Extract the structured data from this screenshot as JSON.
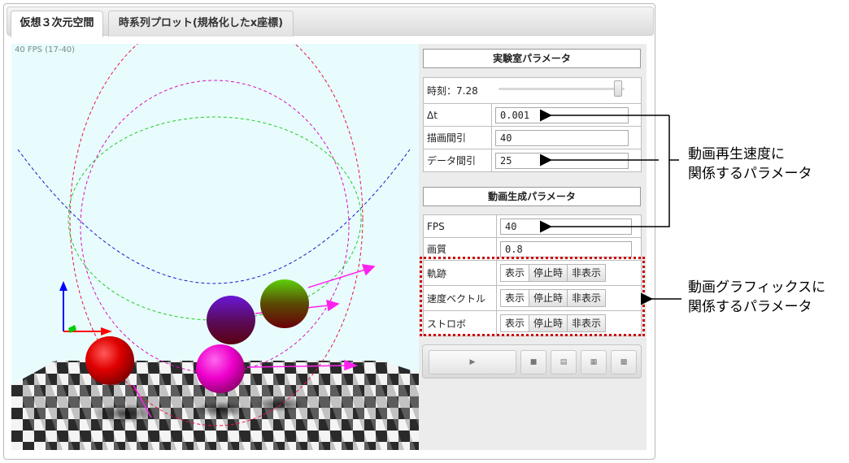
{
  "tabs": [
    {
      "label": "仮想３次元空間",
      "active": true
    },
    {
      "label": "時系列プロット(規格化したx座標)",
      "active": false
    }
  ],
  "viewport": {
    "fps_text": "40 FPS (17-40)"
  },
  "experiment": {
    "header": "実験室パラメータ",
    "time_label": "時刻：7.28",
    "time_slider_fraction": 0.95,
    "rows": [
      {
        "label": "Δt",
        "value": "0.001"
      },
      {
        "label": "描画間引",
        "value": "40"
      },
      {
        "label": "データ間引",
        "value": "25"
      }
    ]
  },
  "animation": {
    "header": "動画生成パラメータ",
    "rows": [
      {
        "label": "FPS",
        "value": "40"
      },
      {
        "label": "画質",
        "value": "0.8"
      }
    ],
    "button_rows": [
      {
        "label": "軌跡",
        "buttons": [
          "表示",
          "停止時",
          "非表示"
        ],
        "selected": 0
      },
      {
        "label": "速度ベクトル",
        "buttons": [
          "表示",
          "停止時",
          "非表示"
        ],
        "selected": 0
      },
      {
        "label": "ストロボ",
        "buttons": [
          "表示",
          "停止時",
          "非表示"
        ],
        "selected": 0
      }
    ]
  },
  "player": {
    "icons": [
      "play-icon",
      "stop-icon",
      "save-icon",
      "image-icon",
      "film-icon"
    ],
    "glyphs": [
      "▶",
      "■",
      "▤",
      "▦",
      "▩"
    ]
  },
  "annotations": {
    "speed": [
      "動画再生速度に",
      "関係するパラメータ"
    ],
    "graphics": [
      "動画グラフィックスに",
      "関係するパラメータ"
    ]
  },
  "colors": {
    "accent_dotted": "#cc0000",
    "viewport_bg": "#e8fcfd"
  }
}
